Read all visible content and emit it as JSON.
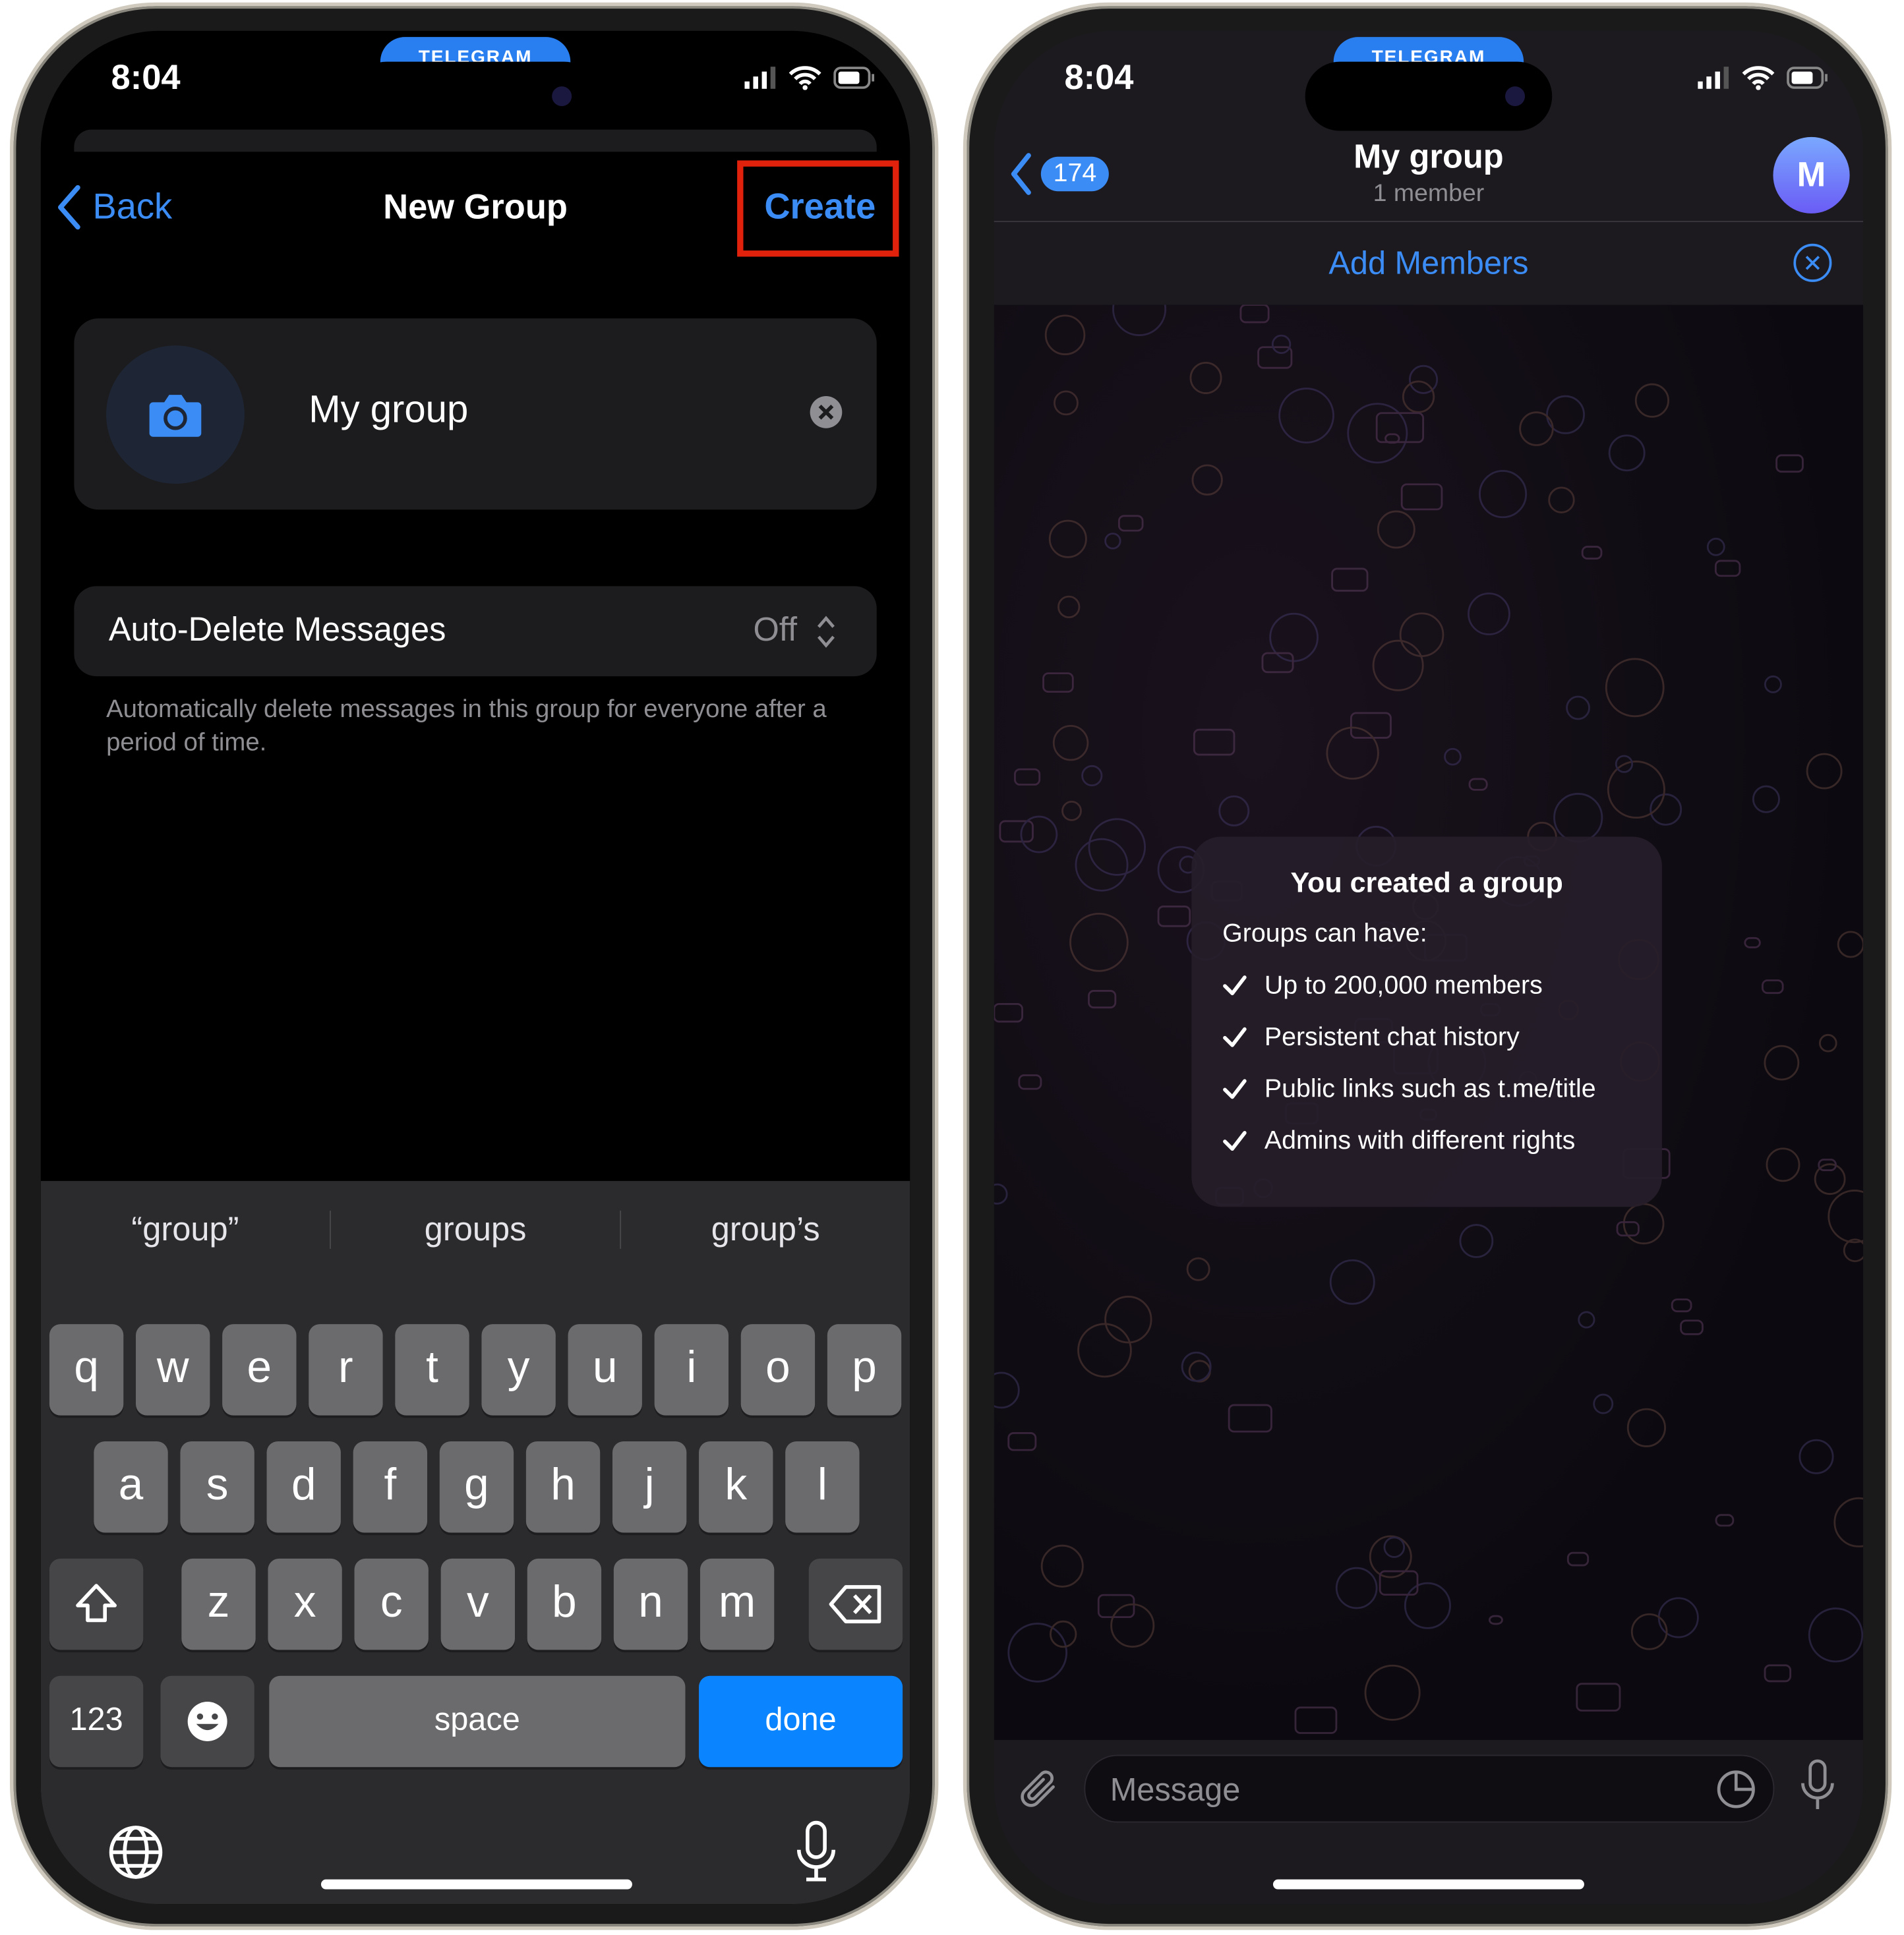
{
  "left": {
    "status": {
      "time": "8:04",
      "app_pill": "TELEGRAM"
    },
    "nav": {
      "back_label": "Back",
      "title": "New Group",
      "create_label": "Create"
    },
    "highlight_color": "#e0210b",
    "group_name": {
      "value": "My group",
      "camera_icon": "camera-icon",
      "clear_icon": "clear-icon"
    },
    "auto_delete": {
      "label": "Auto-Delete Messages",
      "value": "Off",
      "footer": "Automatically delete messages in this group for everyone after a period of time."
    },
    "keyboard": {
      "suggestions": [
        "“group”",
        "groups",
        "group’s"
      ],
      "row1": [
        "q",
        "w",
        "e",
        "r",
        "t",
        "y",
        "u",
        "i",
        "o",
        "p"
      ],
      "row2": [
        "a",
        "s",
        "d",
        "f",
        "g",
        "h",
        "j",
        "k",
        "l"
      ],
      "row3": [
        "z",
        "x",
        "c",
        "v",
        "b",
        "n",
        "m"
      ],
      "numbers_label": "123",
      "space_label": "space",
      "done_label": "done"
    }
  },
  "right": {
    "status": {
      "time": "8:04",
      "app_pill": "TELEGRAM"
    },
    "header": {
      "back_badge": "174",
      "title": "My group",
      "subtitle": "1 member",
      "avatar_letter": "M"
    },
    "add_members_label": "Add Members",
    "info_card": {
      "title": "You created a group",
      "intro": "Groups can have:",
      "features": [
        "Up to 200,000 members",
        "Persistent chat history",
        "Public links such as t.me/title",
        "Admins with different rights"
      ]
    },
    "input": {
      "placeholder": "Message"
    }
  },
  "colors": {
    "accent": "#3b8cf5",
    "done_key": "#0a84ff"
  }
}
